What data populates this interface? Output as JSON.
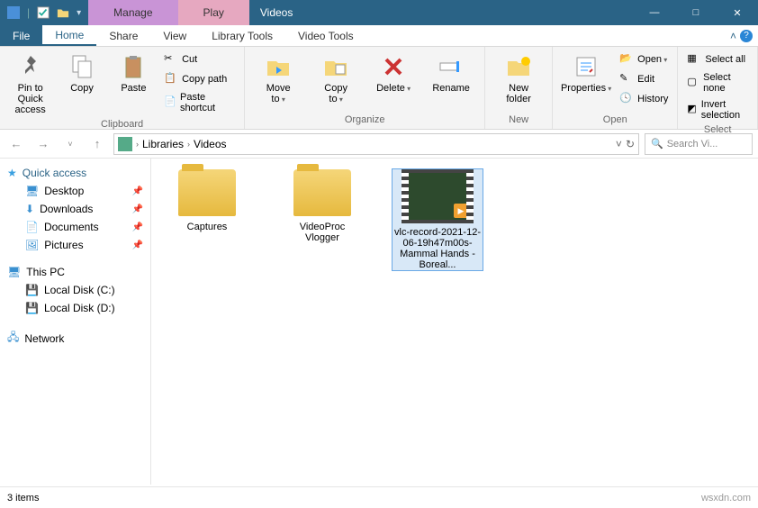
{
  "titlebar": {
    "title": "Videos",
    "context": {
      "manage": "Manage",
      "play": "Play"
    },
    "win": {
      "min": "—",
      "max": "□",
      "close": "✕"
    }
  },
  "tabs": {
    "file": "File",
    "home": "Home",
    "share": "Share",
    "view": "View",
    "library": "Library Tools",
    "video": "Video Tools"
  },
  "ribbon": {
    "pin": "Pin to Quick\naccess",
    "copy": "Copy",
    "paste": "Paste",
    "cut": "Cut",
    "copypath": "Copy path",
    "pasteshortcut": "Paste shortcut",
    "clipboard": "Clipboard",
    "moveto": "Move\nto",
    "copyto": "Copy\nto",
    "delete": "Delete",
    "rename": "Rename",
    "organize": "Organize",
    "newfolder": "New\nfolder",
    "new": "New",
    "properties": "Properties",
    "opencol": "Open",
    "open": "Open",
    "edit": "Edit",
    "history": "History",
    "selectall": "Select all",
    "selectnone": "Select none",
    "invert": "Invert selection",
    "select": "Select"
  },
  "addr": {
    "libraries": "Libraries",
    "videos": "Videos",
    "refreshbtns": "˅",
    "search": "Search Vi..."
  },
  "nav": {
    "quick": "Quick access",
    "desktop": "Desktop",
    "downloads": "Downloads",
    "documents": "Documents",
    "pictures": "Pictures",
    "thispc": "This PC",
    "disk_c": "Local Disk (C:)",
    "disk_d": "Local Disk (D:)",
    "network": "Network"
  },
  "items": {
    "captures": "Captures",
    "videoproc": "VideoProc\nVlogger",
    "vlc": "vlc-record-2021-12-06-19h47m00s-Mammal Hands - Boreal..."
  },
  "status": {
    "count": "3 items",
    "watermark": "wsxdn.com"
  }
}
